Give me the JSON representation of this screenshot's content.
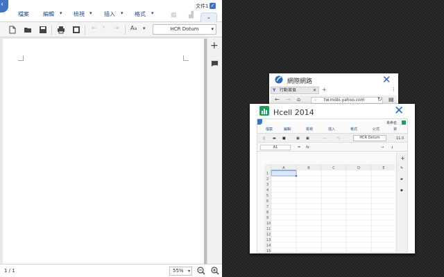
{
  "editor": {
    "menu": [
      "檔案",
      "編輯",
      "檢視",
      "插入",
      "格式"
    ],
    "doc_name": "文件1",
    "font": "HCR Dotum",
    "zoom": "55%",
    "page_count": "1 / 1"
  },
  "switcher": {
    "browser_card": {
      "title": "網際網路",
      "tab_label": "行動首頁",
      "url": "tw.mobi.yahoo.com"
    },
    "hcell_card": {
      "title": "Hcell 2014",
      "mini_menu": [
        "檔案",
        "編輯",
        "檢視",
        "插入",
        "格式",
        "公式",
        "資"
      ],
      "mini_label": "未命名",
      "mini_font": "HCR Dotum",
      "mini_fontsize": "11.0",
      "cell_ref": "A1",
      "columns": [
        "A",
        "B",
        "C",
        "D",
        "E"
      ],
      "rows": [
        "1",
        "2",
        "3",
        "4",
        "5",
        "6",
        "7",
        "8",
        "9",
        "10",
        "11",
        "12",
        "13",
        "14",
        "15"
      ]
    }
  },
  "colors": {
    "accent": "#3f74c4",
    "link": "#2a6ab8",
    "hcell_green": "#1aa05a"
  }
}
